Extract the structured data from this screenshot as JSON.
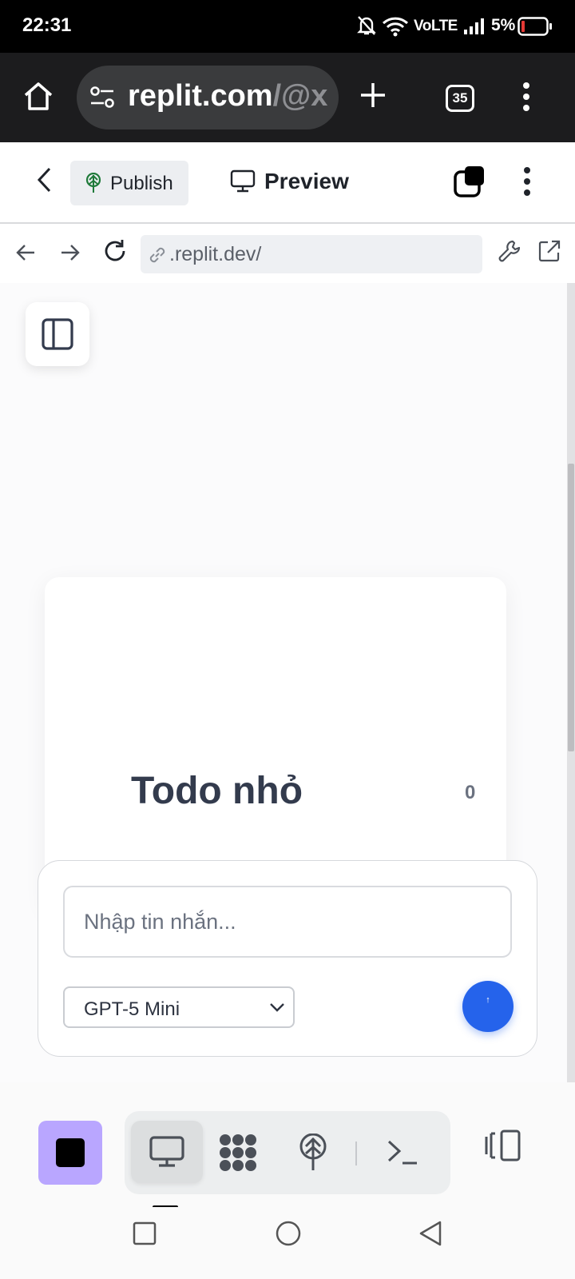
{
  "status_bar": {
    "time": "22:31",
    "network": "VoLTE",
    "battery": "5%"
  },
  "browser": {
    "url_main": "replit.com",
    "url_rest": "/@x",
    "tab_count": "35"
  },
  "replit_header": {
    "publish_label": "Publish",
    "preview_label": "Preview"
  },
  "address_bar": {
    "url": ".replit.dev/"
  },
  "app": {
    "title": "Todo nhỏ",
    "count": "0"
  },
  "composer": {
    "placeholder": "Nhập tin nhắn...",
    "model": "GPT-5 Mini",
    "send_glyph": "↑"
  },
  "colors": {
    "accent_blue": "#2563eb",
    "stop_purple": "#b9a6ff",
    "publish_green": "#1f7a3a"
  },
  "icons": {
    "home": "home-icon",
    "site_settings": "tune-icon",
    "new_tab": "plus-icon",
    "menu": "kebab-menu-icon",
    "back": "chevron-left-icon",
    "publish": "publish-tree-icon",
    "preview": "monitor-icon",
    "layers": "layers-icon",
    "nav_back": "arrow-left-icon",
    "nav_forward": "arrow-right-icon",
    "reload": "reload-icon",
    "link": "link-icon",
    "devtools": "wrench-icon",
    "open_external": "external-link-icon",
    "sidebar": "sidebar-panel-icon",
    "select_arrow": "chevron-down-icon",
    "stop": "stop-icon",
    "tool_preview": "monitor-icon",
    "tool_agent": "agent-dots-icon",
    "tool_publish": "publish-tree-icon",
    "tool_shell": "terminal-icon",
    "tool_split": "split-panel-icon",
    "android_recents": "recents-icon",
    "android_home": "circle-home-icon",
    "android_back": "triangle-back-icon"
  }
}
